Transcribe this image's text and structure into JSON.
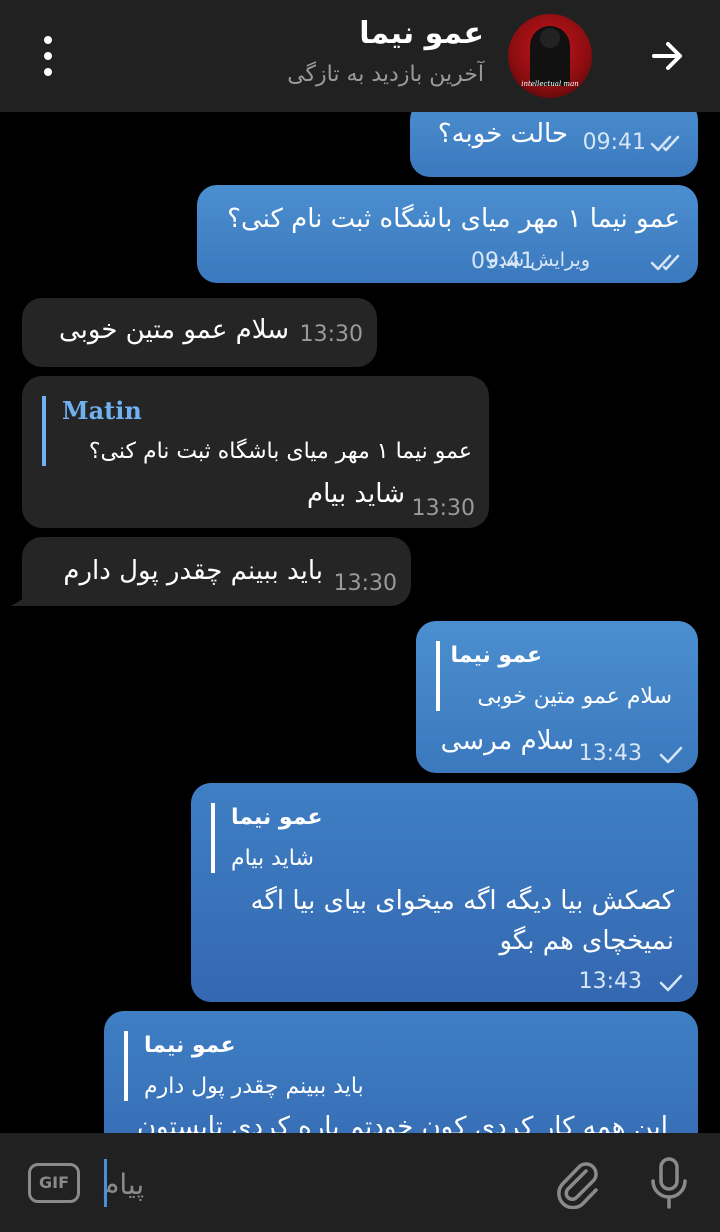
{
  "header": {
    "contact_name": "عمو نیما",
    "status": "آخرین بازدید به تازگی",
    "avatar_caption": "intellectual man"
  },
  "messages": [
    {
      "id": "m1",
      "direction": "out",
      "text": "حالت خوبه؟",
      "time": "09:41",
      "status": "read"
    },
    {
      "id": "m2",
      "direction": "out",
      "text": "عمو نیما ۱ مهر میای باشگاه ثبت نام کنی؟",
      "time": "09:41",
      "edited_label": "ویرایش شده",
      "status": "read"
    },
    {
      "id": "m3",
      "direction": "in",
      "text": "سلام عمو متین خوبی",
      "time": "13:30"
    },
    {
      "id": "m4",
      "direction": "in",
      "reply_name": "Matin",
      "reply_text": "عمو نیما ۱ مهر میای باشگاه ثبت نام کنی؟",
      "text": "شاید بیام",
      "time": "13:30"
    },
    {
      "id": "m5",
      "direction": "in",
      "text": "باید ببینم چقدر پول دارم",
      "time": "13:30"
    },
    {
      "id": "m6",
      "direction": "out",
      "reply_name": "عمو نیما",
      "reply_text": "سلام عمو متین خوبی",
      "text": "سلام مرسی",
      "time": "13:43",
      "status": "sent"
    },
    {
      "id": "m7",
      "direction": "out",
      "reply_name": "عمو نیما",
      "reply_text": "شاید بیام",
      "text": "کصکش بیا دیگه اگه میخوای بیای بیا اگه نمیخچای هم بگو",
      "time": "13:43",
      "status": "sent"
    },
    {
      "id": "m8",
      "direction": "out",
      "reply_name": "عمو نیما",
      "reply_text": "باید ببینم چقدر پول دارم",
      "text": "این همه کار کردی کون خودتم پاره کردی تابستون"
    }
  ],
  "input": {
    "placeholder": "پیام",
    "gif_label": "GIF"
  },
  "icons": {
    "back": "arrow-right-icon",
    "menu": "more-vertical-icon",
    "read": "double-check-icon",
    "sent": "check-icon",
    "attach": "paperclip-icon",
    "mic": "microphone-icon"
  },
  "colors": {
    "header_bg": "#212121",
    "outgoing_bubble": "#4b8fd0",
    "incoming_bubble": "#252526",
    "reply_accent_in": "#6fb1f1"
  }
}
